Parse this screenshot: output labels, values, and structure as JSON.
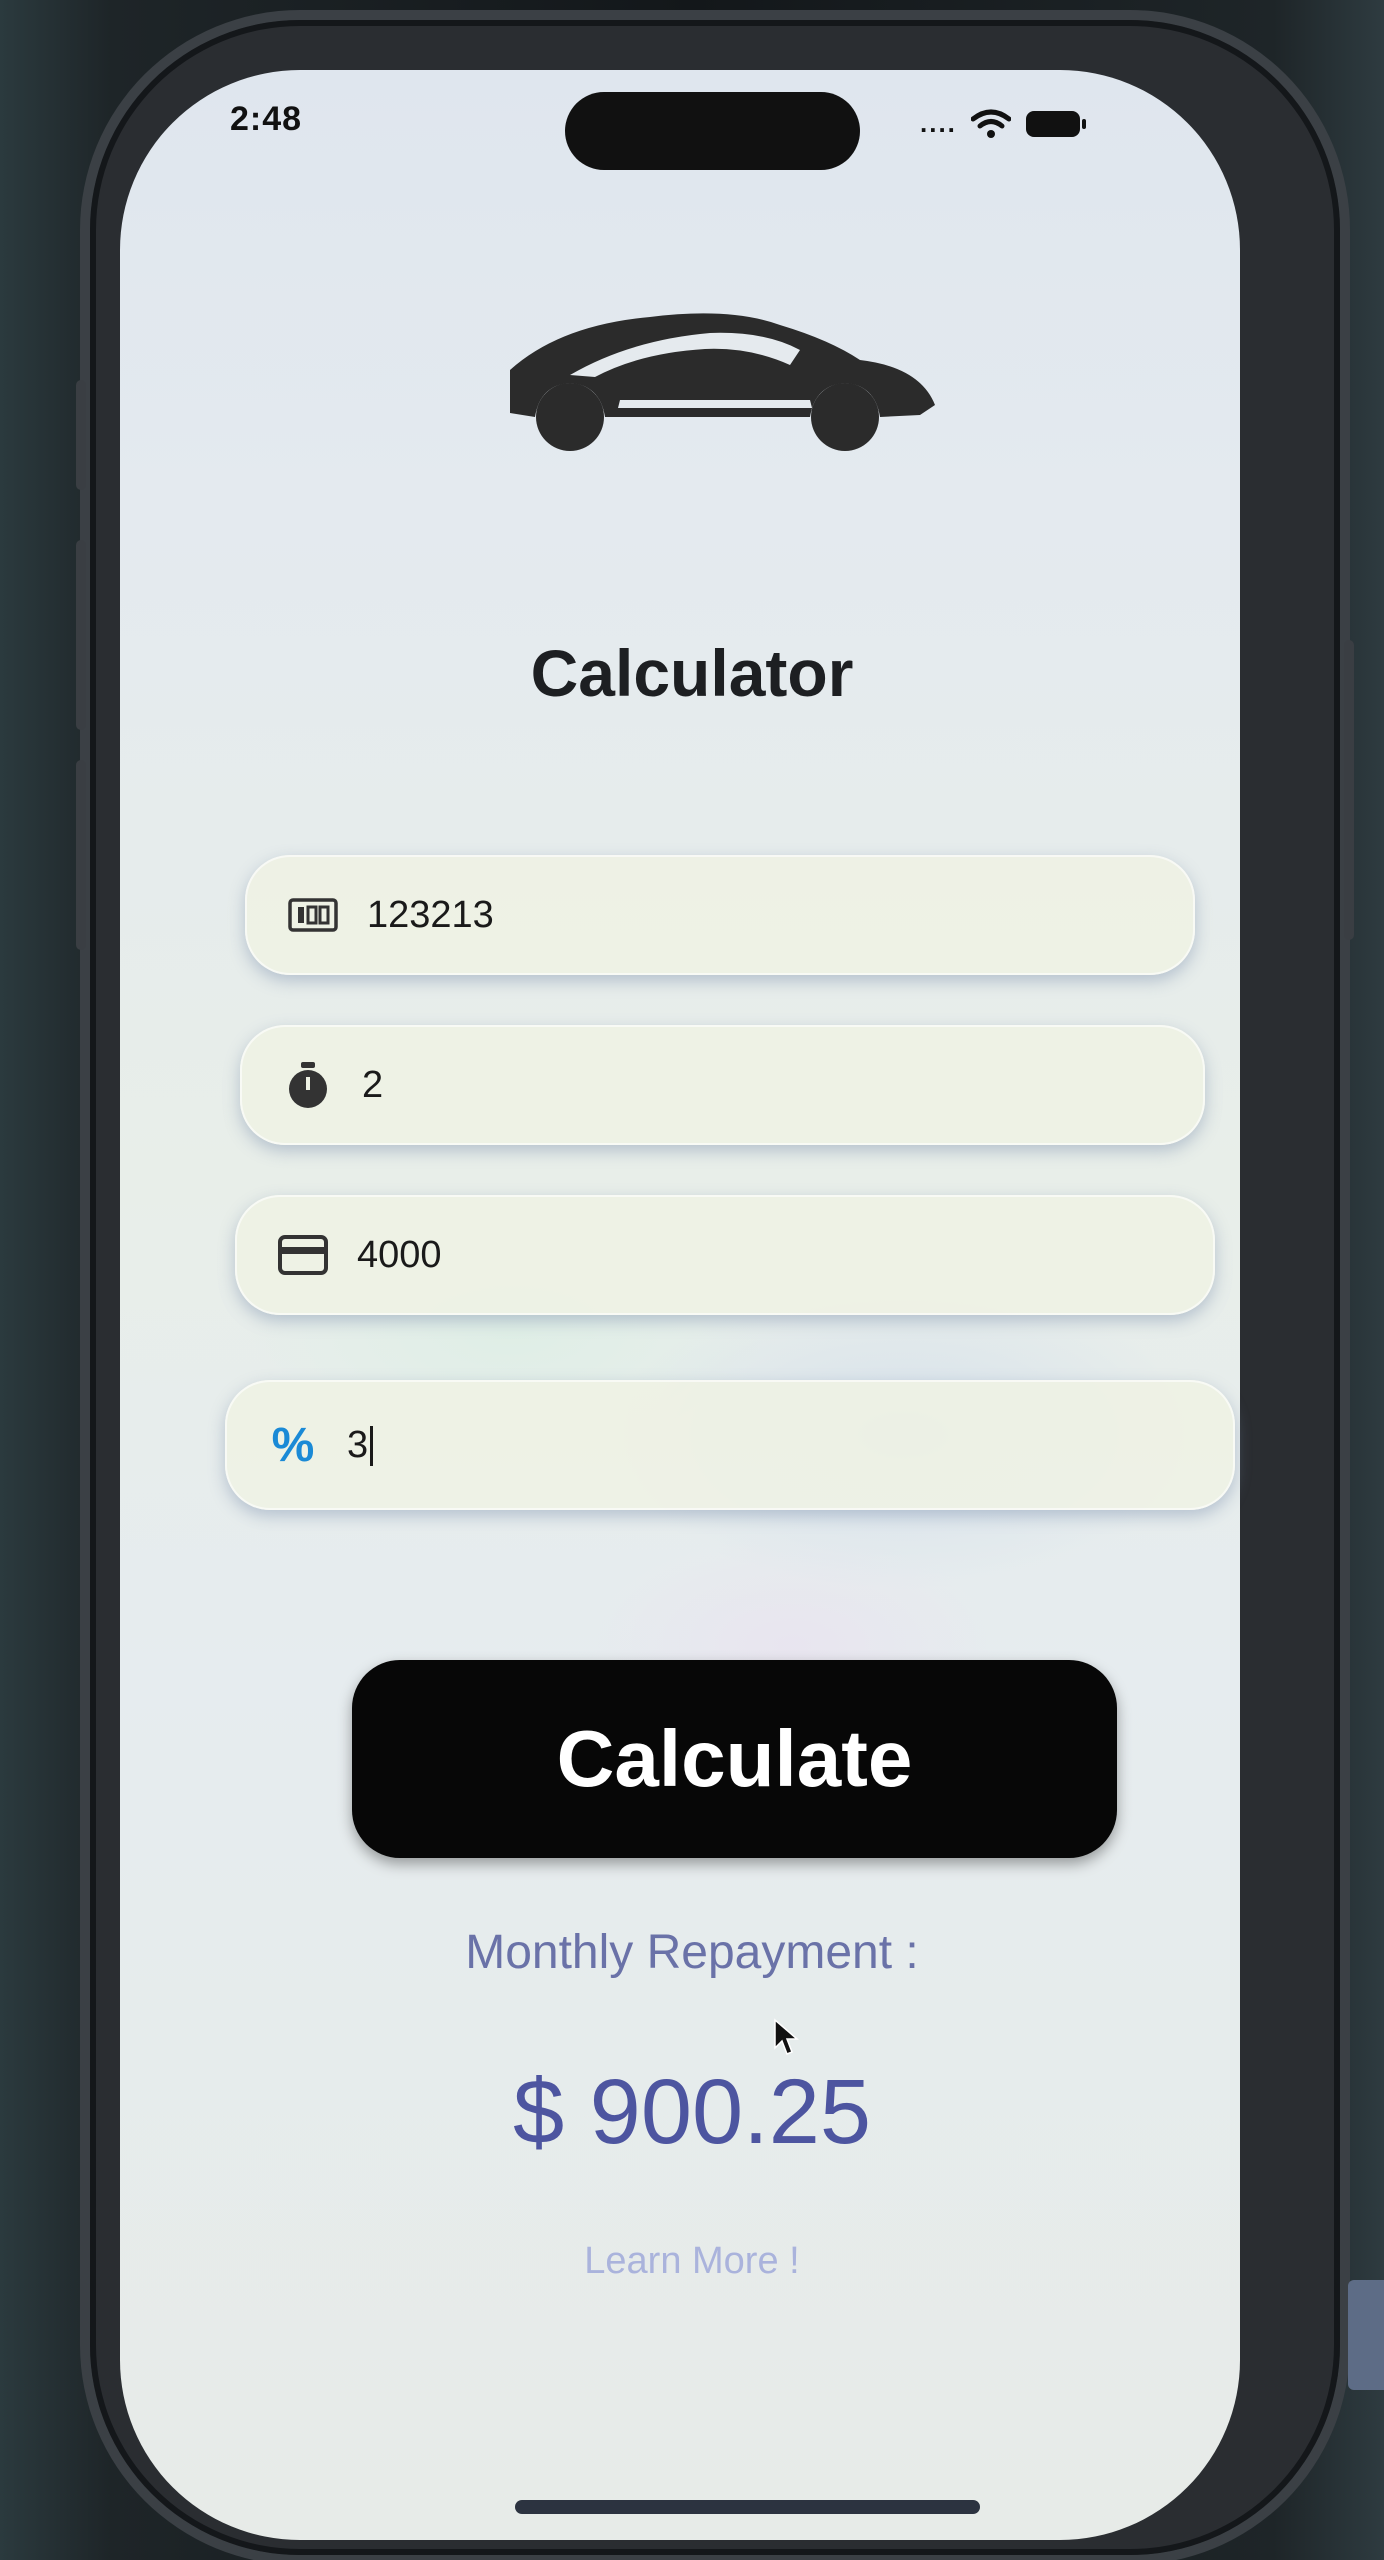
{
  "status_bar": {
    "time": "2:48",
    "signal": "....",
    "wifi_icon": "wifi-icon",
    "battery_icon": "battery-icon"
  },
  "header": {
    "logo_icon": "car-icon",
    "title": "Calculator"
  },
  "form": {
    "fields": [
      {
        "icon": "price-tag-icon",
        "value": "123213"
      },
      {
        "icon": "stopwatch-icon",
        "value": "2"
      },
      {
        "icon": "credit-card-icon",
        "value": "4000"
      },
      {
        "icon": "percent-icon",
        "value": "3"
      }
    ]
  },
  "actions": {
    "calculate_label": "Calculate"
  },
  "result": {
    "label": "Monthly Repayment :",
    "value": "$ 900.25",
    "learn_more": "Learn More !"
  },
  "colors": {
    "button_bg": "#070707",
    "result_text": "#4d55a0",
    "link_text": "#aab3dc",
    "percent_icon": "#1a8ad6"
  }
}
